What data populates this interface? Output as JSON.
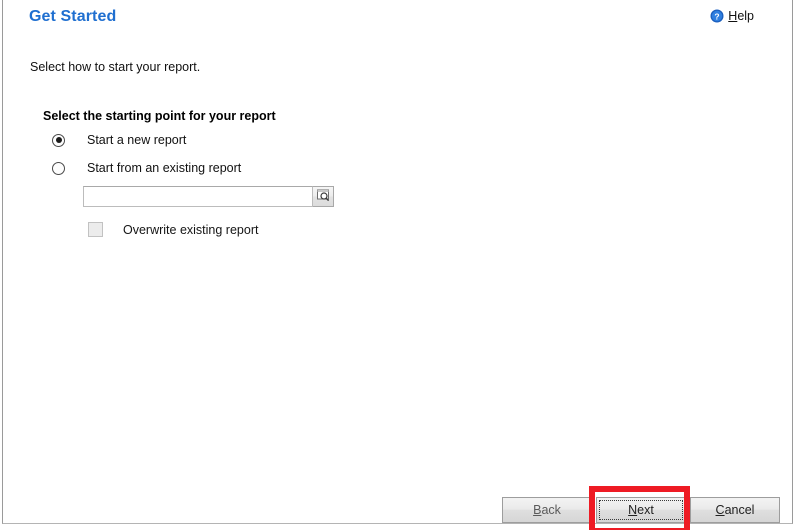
{
  "window": {
    "title": "Get Started"
  },
  "header": {
    "title": "Get Started",
    "help": {
      "icon": "help-circle-icon",
      "accel": "H",
      "rest": "elp"
    }
  },
  "body": {
    "intro": "Select how to start your report.",
    "group_title": "Select the starting point for your report",
    "options": [
      {
        "label": "Start a new report",
        "selected": true
      },
      {
        "label": "Start from an existing report",
        "selected": false
      }
    ],
    "existing_report_field": {
      "value": "",
      "placeholder": "",
      "browse_icon": "browse-magnifier-icon"
    },
    "overwrite_checkbox": {
      "label": "Overwrite existing report",
      "checked": false,
      "disabled": true
    }
  },
  "footer": {
    "buttons": [
      {
        "name": "back",
        "accel": "B",
        "rest": "ack",
        "disabled": true,
        "focused": false
      },
      {
        "name": "next",
        "accel": "N",
        "rest": "ext",
        "disabled": false,
        "focused": true
      },
      {
        "name": "cancel",
        "accel": "C",
        "rest": "ancel",
        "disabled": false,
        "focused": false
      }
    ]
  },
  "annotation": {
    "type": "highlight-rectangle",
    "target": "next-button",
    "color": "#ee1b24"
  },
  "colors": {
    "title": "#1f6fd0",
    "text": "#111111",
    "highlight": "#ee1b24",
    "button_face": "#e6e6e6"
  }
}
